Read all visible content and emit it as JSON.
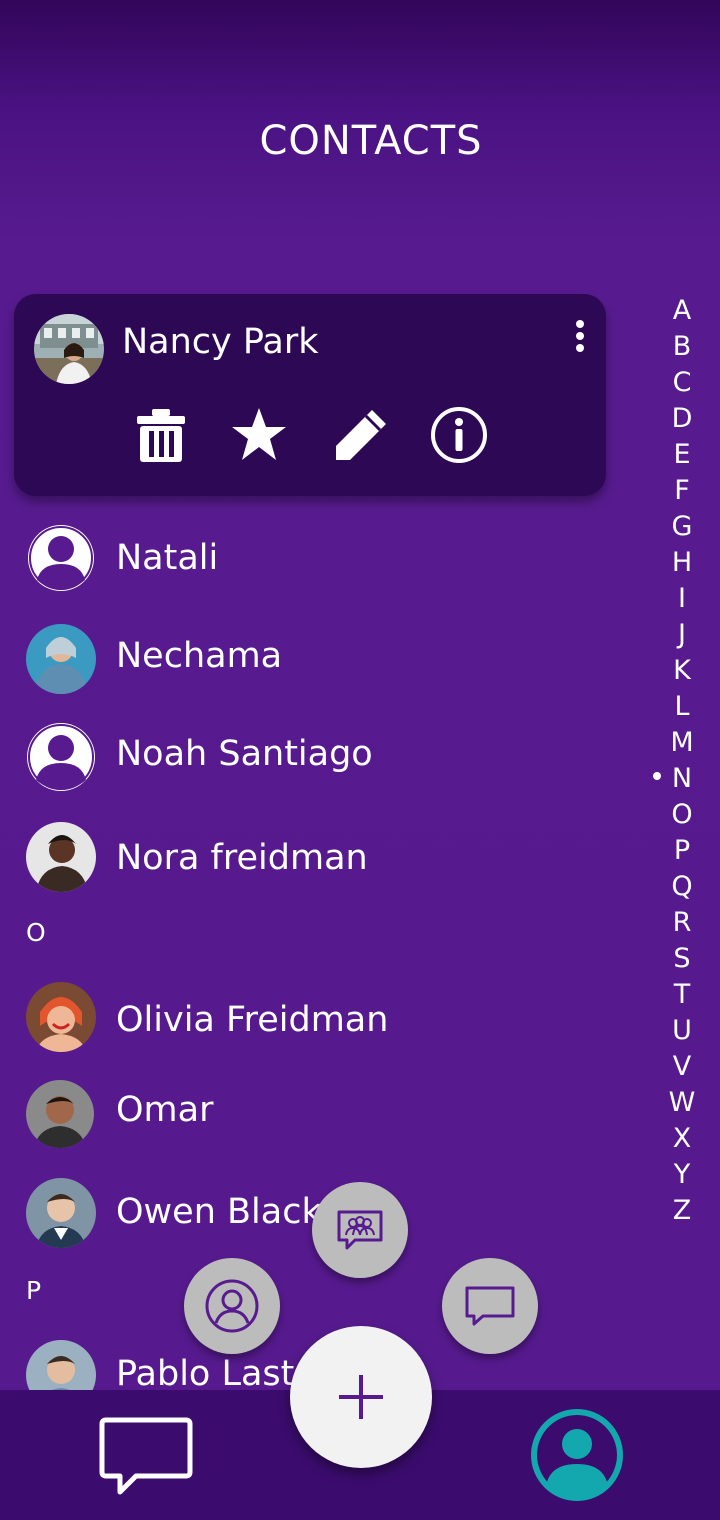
{
  "header": {
    "title": "CONTACTS"
  },
  "selected_contact": {
    "name": "Nancy Park",
    "actions": [
      "trash-icon",
      "star-icon",
      "pencil-icon",
      "info-icon"
    ]
  },
  "contacts": [
    {
      "name": "Natali",
      "avatar": "default"
    },
    {
      "name": "Nechama",
      "avatar": "photo"
    },
    {
      "name": "Noah Santiago",
      "avatar": "default"
    },
    {
      "name": "Nora freidman",
      "avatar": "photo"
    },
    {
      "name": "Olivia Freidman",
      "avatar": "photo"
    },
    {
      "name": "Omar",
      "avatar": "photo"
    },
    {
      "name": "Owen Black",
      "avatar": "photo"
    },
    {
      "name": "Pablo Last",
      "avatar": "photo"
    }
  ],
  "sections": {
    "o": "O",
    "p": "P"
  },
  "alphabet": [
    "A",
    "B",
    "C",
    "D",
    "E",
    "F",
    "G",
    "H",
    "I",
    "J",
    "K",
    "L",
    "M",
    "N",
    "O",
    "P",
    "Q",
    "R",
    "S",
    "T",
    "U",
    "V",
    "W",
    "X",
    "Y",
    "Z"
  ],
  "alphabet_current": "N",
  "fab": {
    "add": "plus-icon",
    "group": "group-chat-icon",
    "contact": "contact-icon",
    "message": "message-icon"
  },
  "bottom_nav": [
    "messages-icon",
    "contacts-icon"
  ],
  "colors": {
    "background": "#571b8f",
    "card": "#2d0855",
    "accent": "#13a8ae",
    "fab": "#bcbcbc"
  }
}
